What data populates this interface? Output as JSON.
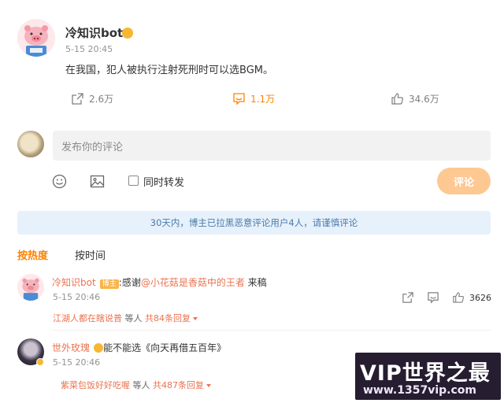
{
  "post": {
    "author": "冷知识bot",
    "time": "5-15 20:45",
    "text": "在我国，犯人被执行注射死刑时可以选BGM。",
    "actions": {
      "share": "2.6万",
      "comment": "1.1万",
      "like": "34.6万"
    }
  },
  "compose": {
    "placeholder": "发布你的评论",
    "repost_label": "同时转发",
    "submit_label": "评论"
  },
  "notice": "30天内，博主已拉黑恶意评论用户4人，请谨慎评论",
  "sort": {
    "hot": "按热度",
    "time": "按时间"
  },
  "comments": [
    {
      "name": "冷知识bot",
      "tag": "博主",
      "prefix": ":感谢",
      "mention": "@小花菇是香菇中的王者",
      "suffix": " 来稿",
      "time": "5-15 20:46",
      "like_count": "3626",
      "reply_user": "江湖人都在瞎说普",
      "reply_mid": " 等人 ",
      "reply_count": "共84条回复"
    },
    {
      "name": "世外玫瑰",
      "text": "能不能选《向天再借五百年》",
      "time": "5-15 20:46",
      "reply_user": "紫菜包饭好好吃喔",
      "reply_mid": " 等人 ",
      "reply_count": "共487条回复"
    }
  ],
  "watermark": {
    "main": "VIP世界之最",
    "sub": "www.1357vip.com"
  },
  "colors": {
    "accent": "#ff8200",
    "link": "#eb7350",
    "submit_disabled": "#fdc892",
    "notice_bg": "#e7f1fb"
  }
}
